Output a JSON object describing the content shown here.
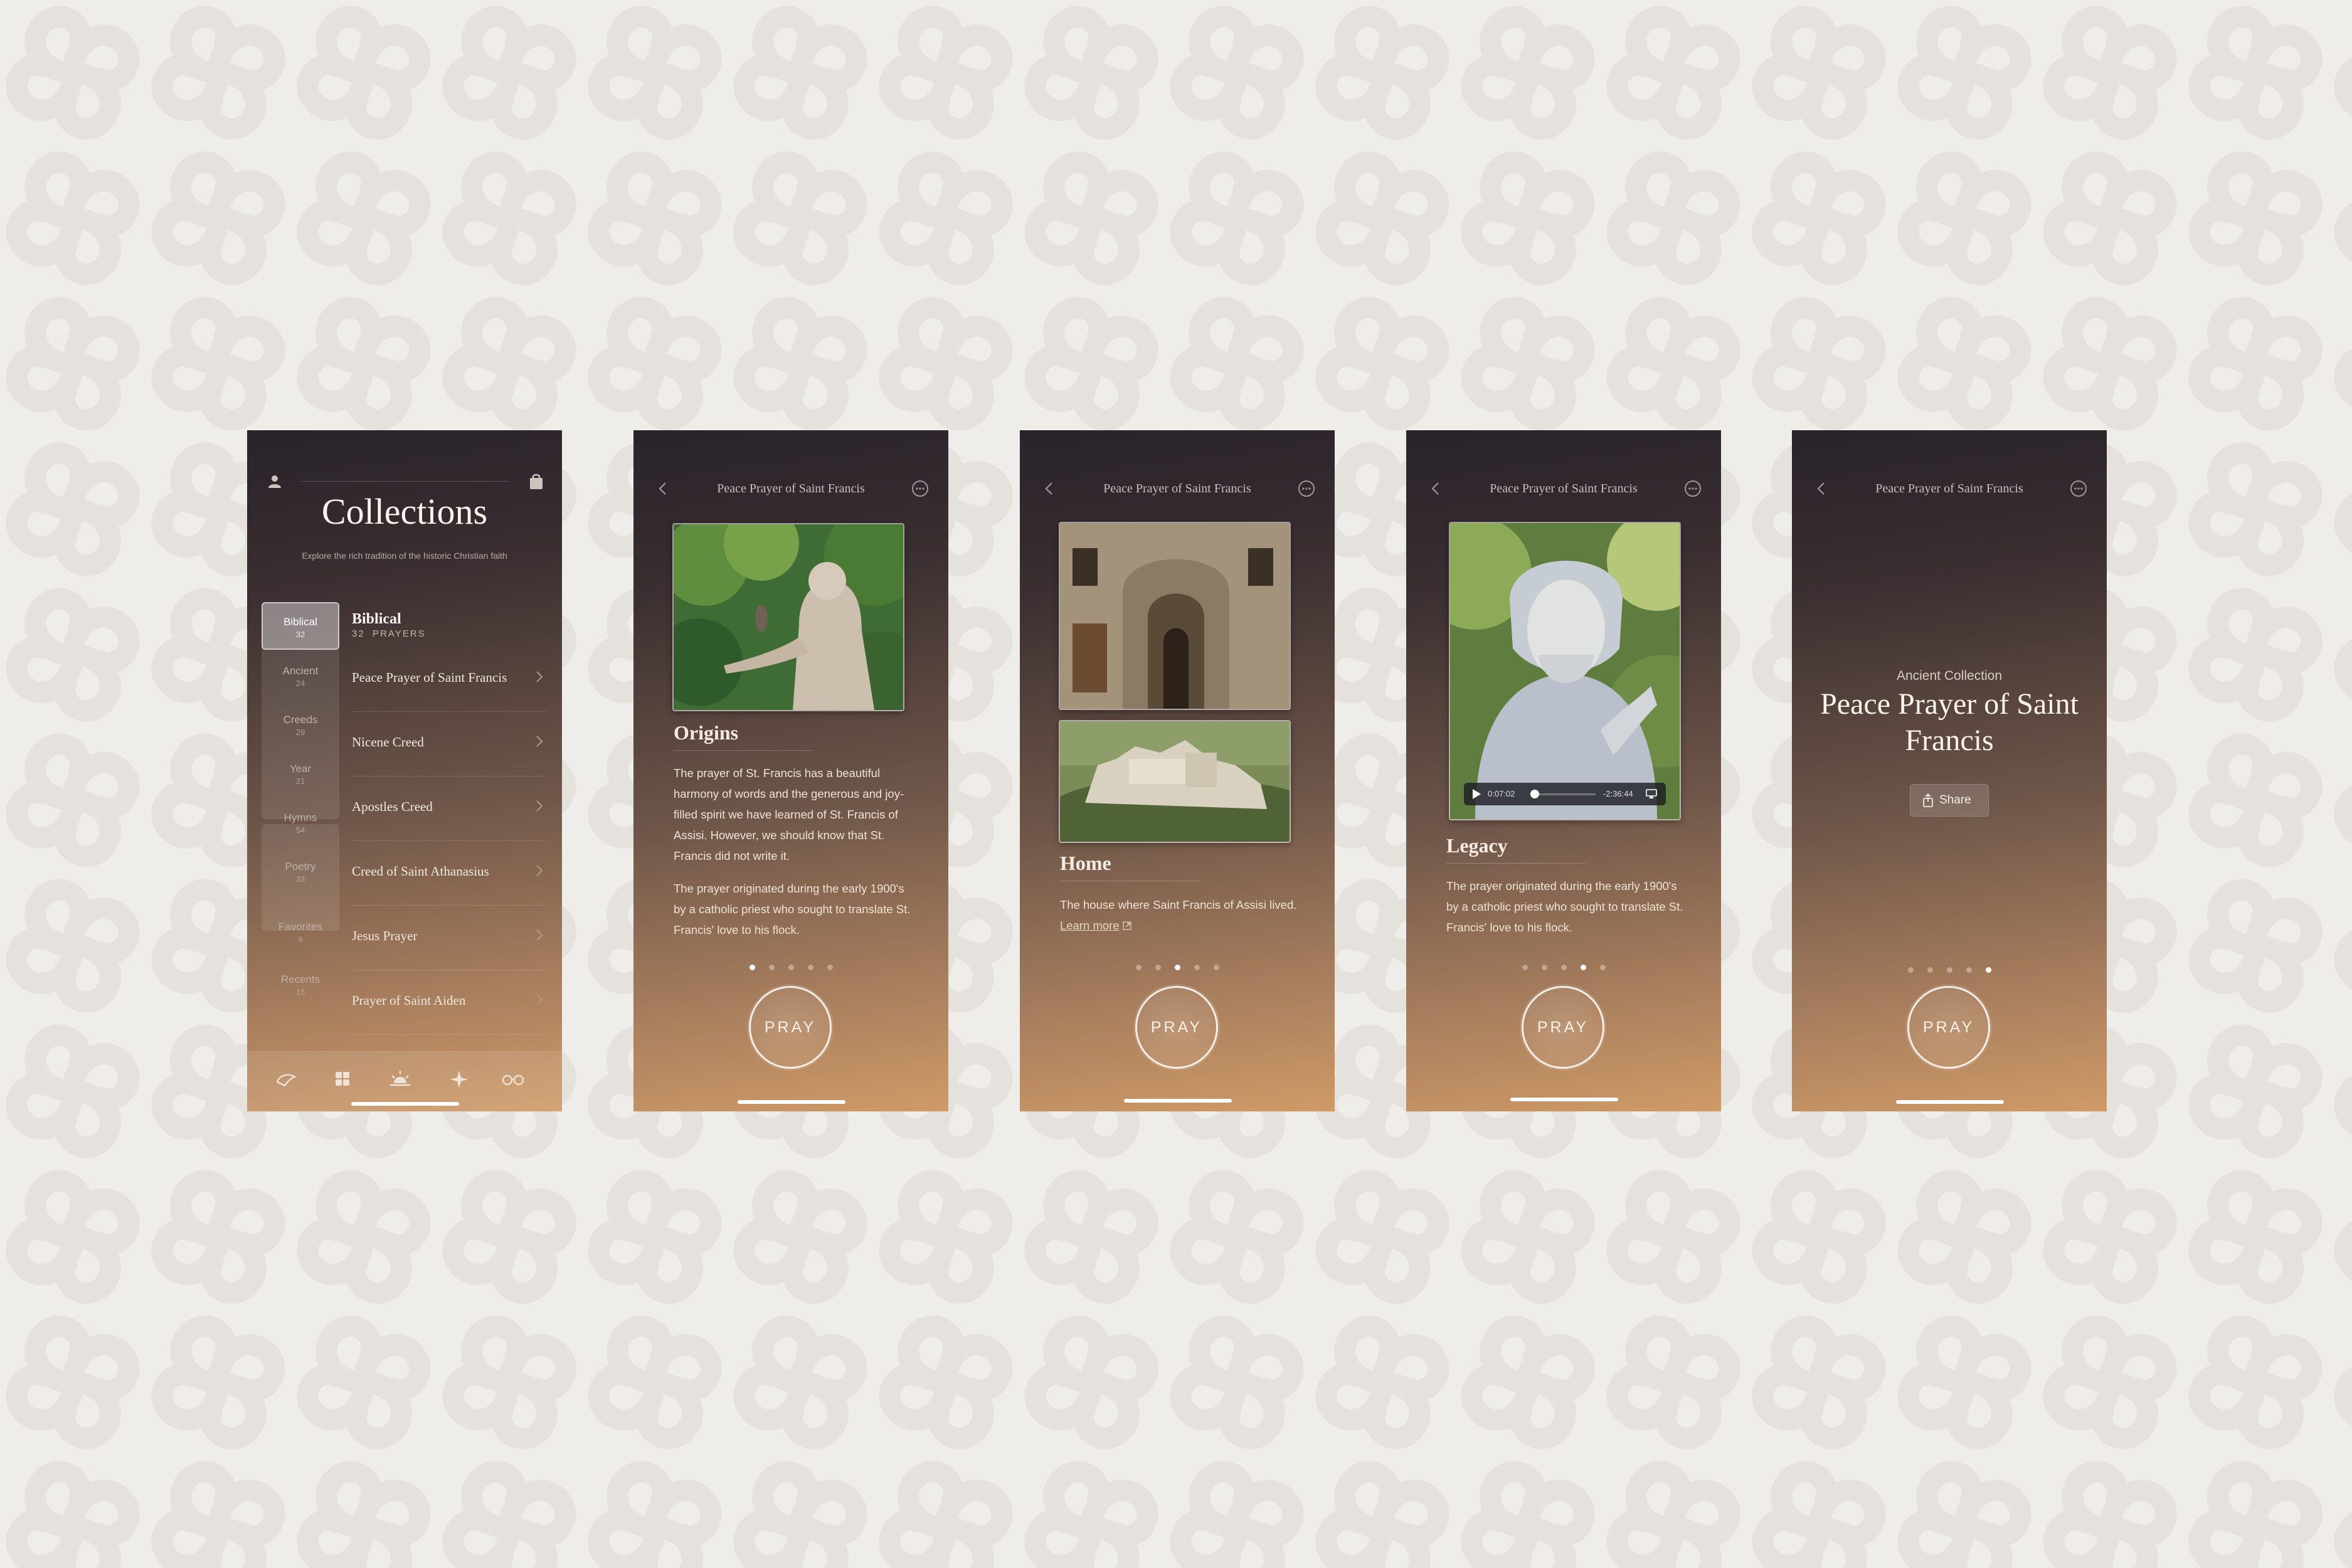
{
  "colors": {
    "background": "#efedea",
    "pattern": "#e6e3df",
    "gradient_top": "#28232b",
    "gradient_bottom": "#cf9a67",
    "text_light": "#f3e6da"
  },
  "collections_screen": {
    "title": "Collections",
    "subtitle": "Explore the rich tradition of the historic Christian faith",
    "icons": [
      "user-icon",
      "bag-icon"
    ],
    "categories": [
      {
        "label": "Biblical",
        "count": "32",
        "active": true
      },
      {
        "label": "Ancient",
        "count": "24"
      },
      {
        "label": "Creeds",
        "count": "29"
      },
      {
        "label": "Year",
        "count": "21"
      },
      {
        "label": "Hymns",
        "count": "54"
      },
      {
        "label": "Poetry",
        "count": "33"
      },
      {
        "label": "Favorites",
        "count": "9"
      },
      {
        "label": "Recents",
        "count": "18"
      }
    ],
    "list_header": {
      "title": "Biblical",
      "count": "32",
      "unit": "PRAYERS"
    },
    "prayers": [
      "Peace Prayer of Saint Francis",
      "Nicene Creed",
      "Apostles Creed",
      "Creed of Saint Athanasius",
      "Jesus Prayer",
      "Prayer of Saint Aiden"
    ],
    "tab_bar_icons": [
      "leaf-icon",
      "grid-icon",
      "sunrise-icon",
      "sparkle-icon",
      "glasses-icon"
    ]
  },
  "detail_title": "Peace Prayer of Saint Francis",
  "pray_label": "PRAY",
  "origins_screen": {
    "heading": "Origins",
    "paragraph1": "The prayer of St. Francis has a beautiful harmony of words and the generous and joy-filled spirit we have learned of St. Francis of Assisi. However, we should know that St. Francis did not write it.",
    "paragraph2": "The prayer originated during the early 1900's by a catholic priest who sought to translate St. Francis' love to his flock.",
    "active_dot": 0
  },
  "home_screen": {
    "heading": "Home",
    "text": "The house where Saint Francis of Assisi lived.",
    "link": "Learn more",
    "active_dot": 2
  },
  "legacy_screen": {
    "heading": "Legacy",
    "text": "The prayer originated during the early 1900's by a catholic priest who sought to translate St. Francis' love to his flock.",
    "video_elapsed": "0:07:02",
    "video_remaining": "-2:36:44",
    "active_dot": 3
  },
  "title_screen": {
    "kicker": "Ancient Collection",
    "title": "Peace Prayer of Saint Francis",
    "share_label": "Share",
    "active_dot": 4
  },
  "dot_count": 5
}
